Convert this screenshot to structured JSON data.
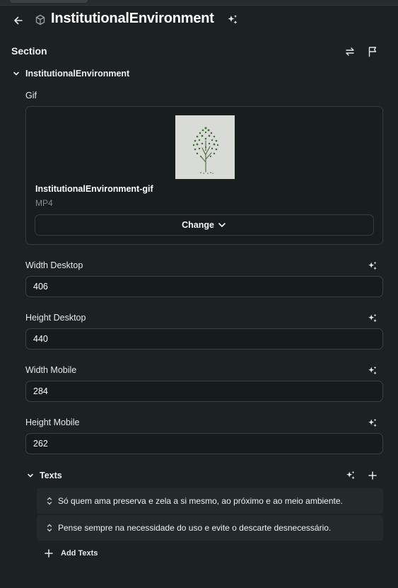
{
  "header": {
    "title": "InstitutionalEnvironment",
    "icons": {
      "back": "arrow-left-icon",
      "type": "cube-icon",
      "ai": "sparkle-icon"
    }
  },
  "section": {
    "title": "Section",
    "icons": {
      "swap": "swap-arrows-icon",
      "flag": "flag-icon"
    }
  },
  "group": {
    "label": "InstitutionalEnvironment",
    "expanded": true
  },
  "gif": {
    "label": "Gif",
    "asset_name": "InstitutionalEnvironment-gif",
    "asset_type": "MP4",
    "change_label": "Change"
  },
  "fields": [
    {
      "label": "Width Desktop",
      "value": "406"
    },
    {
      "label": "Height Desktop",
      "value": "440"
    },
    {
      "label": "Width Mobile",
      "value": "284"
    },
    {
      "label": "Height Mobile",
      "value": "262"
    }
  ],
  "texts": {
    "label": "Texts",
    "expanded": true,
    "items": [
      {
        "label": "Só quem ama preserva e zela a si mesmo, ao próximo e ao meio ambiente."
      },
      {
        "label": "Pense sempre na necessidade do uso e evite o descarte desnecessário."
      }
    ],
    "add_label": "Add Texts"
  },
  "colors": {
    "background": "#1b2221",
    "card_background": "#171e1d",
    "border": "#353e3c",
    "text_primary": "#ffffff",
    "text_muted": "#858d8a",
    "list_item_background": "#232b2a"
  }
}
